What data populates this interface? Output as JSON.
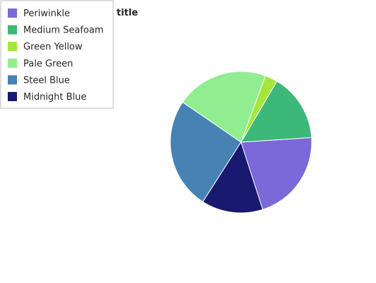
{
  "chart_data": {
    "type": "pie",
    "title": "title",
    "labels": [
      "Periwinkle",
      "Medium Seafoam",
      "Green Yellow",
      "Pale Green",
      "Steel Blue",
      "Midnight Blue"
    ],
    "values": [
      19.2,
      14.1,
      2.6,
      19.2,
      23.2,
      12.8
    ],
    "colors": [
      "#7b68d9",
      "#3cb878",
      "#a5e63a",
      "#90ee90",
      "#4682b4",
      "#191970"
    ],
    "legend": "top-left"
  }
}
